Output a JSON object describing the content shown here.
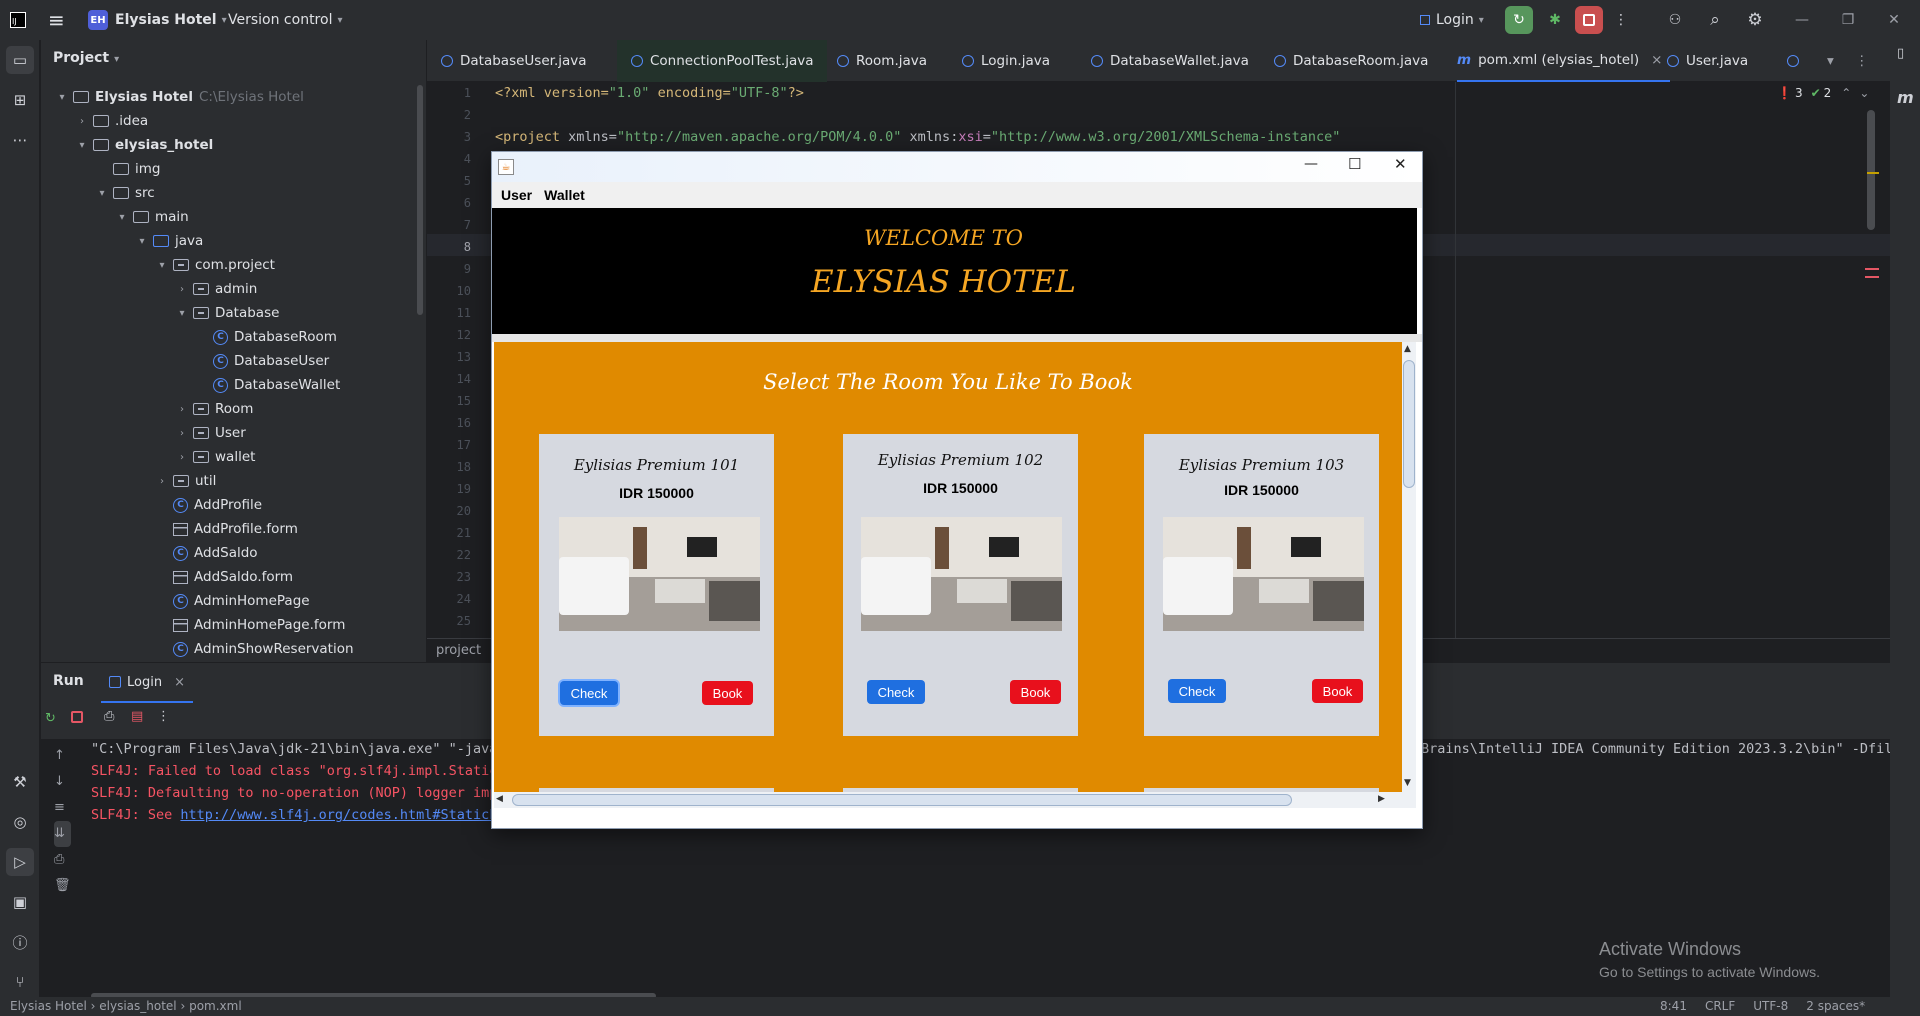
{
  "titlebar": {
    "project_badge": "EH",
    "project_name": "Elysias Hotel",
    "vcs": "Version control",
    "run_config": "Login"
  },
  "project_panel": {
    "title": "Project",
    "tree": [
      {
        "label": "Elysias Hotel",
        "path": "C:\\Elysias Hotel"
      },
      {
        "label": ".idea"
      },
      {
        "label": "elysias_hotel"
      },
      {
        "label": "img"
      },
      {
        "label": "src"
      },
      {
        "label": "main"
      },
      {
        "label": "java"
      },
      {
        "label": "com.project"
      },
      {
        "label": "admin"
      },
      {
        "label": "Database"
      },
      {
        "label": "DatabaseRoom"
      },
      {
        "label": "DatabaseUser"
      },
      {
        "label": "DatabaseWallet"
      },
      {
        "label": "Room"
      },
      {
        "label": "User"
      },
      {
        "label": "wallet"
      },
      {
        "label": "util"
      },
      {
        "label": "AddProfile"
      },
      {
        "label": "AddProfile.form"
      },
      {
        "label": "AddSaldo"
      },
      {
        "label": "AddSaldo.form"
      },
      {
        "label": "AdminHomePage"
      },
      {
        "label": "AdminHomePage.form"
      },
      {
        "label": "AdminShowReservation"
      }
    ]
  },
  "editor": {
    "tabs": [
      "DatabaseUser.java",
      "ConnectionPoolTest.java",
      "Room.java",
      "Login.java",
      "DatabaseWallet.java",
      "DatabaseRoom.java",
      "pom.xml (elysias_hotel)",
      "User.java"
    ],
    "active_tab": "pom.xml (elysias_hotel)",
    "line_numbers": [
      "1",
      "2",
      "3",
      "4",
      "5",
      "6",
      "7",
      "8",
      "9",
      "10",
      "11",
      "12",
      "13",
      "14",
      "15",
      "16",
      "17",
      "18",
      "19",
      "20",
      "21",
      "22",
      "23",
      "24",
      "25"
    ],
    "code_line1": {
      "a": "<?xml version=",
      "b": "\"1.0\"",
      "c": " encoding=",
      "d": "\"UTF-8\"",
      "e": "?>"
    },
    "code_line3": {
      "a": "<project ",
      "b": "xmlns=",
      "c": "\"http://maven.apache.org/POM/4.0.0\"",
      "d": " xmlns:",
      "e": "xsi",
      "f": "=",
      "g": "\"http://www.w3.org/2001/XMLSchema-instance\""
    },
    "errors": "3",
    "warnings": "2",
    "breadcrumb": "project"
  },
  "run_panel": {
    "title": "Run",
    "tab": "Login",
    "console": [
      "\"C:\\Program Files\\Java\\jdk-21\\bin\\java.exe\" \"-java",
      "SLF4J: Failed to load class \"org.slf4j.impl.Static",
      "SLF4J: Defaulting to no-operation (NOP) logger imp",
      "SLF4J: See "
    ],
    "console_link": "http://www.slf4j.org/codes.html#StaticL",
    "console_tail": "Brains\\IntelliJ IDEA Community Edition 2023.3.2\\bin\" -Dfil"
  },
  "activate": {
    "title": "Activate Windows",
    "subtitle": "Go to Settings to activate Windows."
  },
  "statusbar": {
    "crumbs": [
      "Elysias Hotel",
      "elysias_hotel",
      "pom.xml"
    ],
    "right": [
      "8:41",
      "CRLF",
      "UTF-8",
      "2 spaces*"
    ]
  },
  "swing": {
    "menu": [
      "User",
      "Wallet"
    ],
    "welcome": "WELCOME TO",
    "hotel": "ELYSIAS HOTEL",
    "heading": "Select The Room You Like To Book",
    "rooms": [
      {
        "name": "Eylisias Premium 101",
        "price": "IDR 150000",
        "check": "Check",
        "book": "Book"
      },
      {
        "name": "Eylisias Premium 102",
        "price": "IDR 150000",
        "check": "Check",
        "book": "Book"
      },
      {
        "name": "Eylisias Premium 103",
        "price": "IDR 150000",
        "check": "Check",
        "book": "Book"
      }
    ],
    "colors": {
      "header": "#000000",
      "content": "#e08a00",
      "gold": "#f5a623",
      "check": "#1f6fe0",
      "book": "#e8101c"
    }
  }
}
